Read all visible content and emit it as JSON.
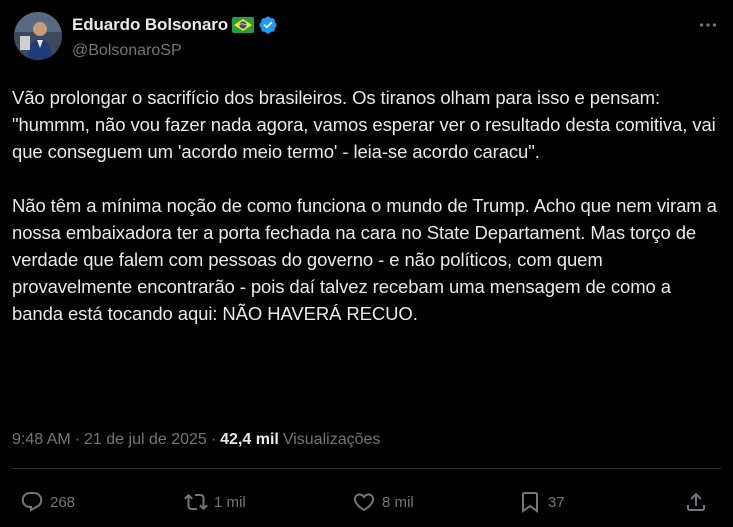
{
  "author": {
    "display_name": "Eduardo Bolsonaro",
    "handle": "@BolsonaroSP"
  },
  "tweet": {
    "text": "Vão prolongar o sacrifício dos brasileiros. Os tiranos olham para isso e pensam: \"hummm, não vou fazer nada agora, vamos esperar ver o resultado desta comitiva, vai que conseguem um 'acordo meio termo' - leia-se acordo caracu\".\n\nNão têm a mínima noção de como funciona o mundo de Trump. Acho que nem viram a nossa embaixadora ter a porta fechada na cara no State Departament. Mas torço de verdade que falem com pessoas do governo - e não políticos, com quem provavelmente encontrarão - pois daí talvez recebam uma mensagem de como a banda está tocando aqui: NÃO HAVERÁ RECUO."
  },
  "meta": {
    "time": "9:48 AM",
    "separator": "·",
    "date": "21 de jul de 2025",
    "separator2": "·",
    "views_count": "42,4 mil",
    "views_label": "Visualizações"
  },
  "actions": {
    "reply_count": "268",
    "retweet_count": "1 mil",
    "like_count": "8 mil",
    "bookmark_count": "37"
  },
  "icons": {
    "verified": "verified-badge-icon",
    "flag": "brazil-flag-icon",
    "more": "more-icon",
    "reply": "reply-icon",
    "retweet": "retweet-icon",
    "like": "heart-icon",
    "bookmark": "bookmark-icon",
    "share": "share-icon"
  },
  "colors": {
    "background": "#000000",
    "text": "#e7e9ea",
    "secondary": "#71767b",
    "verified": "#1d9bf0"
  }
}
